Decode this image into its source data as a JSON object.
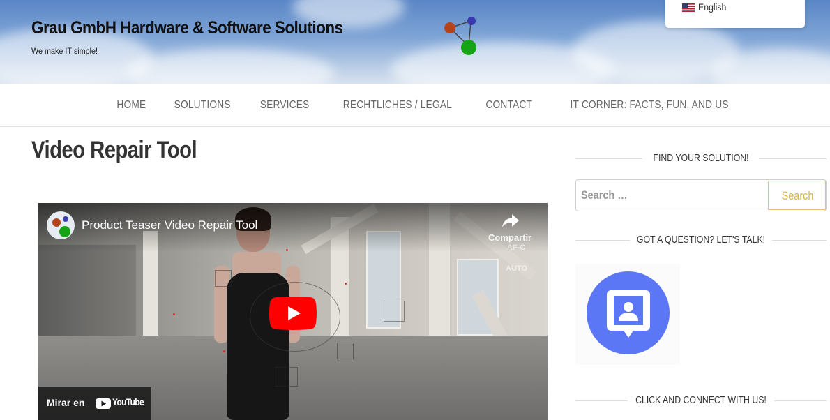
{
  "header": {
    "site_title": "Grau GmbH Hardware & Software Solutions",
    "tagline": "We make IT simple!",
    "language": "English"
  },
  "nav": {
    "items": [
      "HOME",
      "SOLUTIONS",
      "SERVICES",
      "RECHTLICHES / LEGAL",
      "CONTACT",
      "IT CORNER: FACTS, FUN, AND US"
    ]
  },
  "main": {
    "page_title": "Video Repair Tool",
    "video": {
      "title": "Product Teaser Video Repair Tool",
      "share_label": "Compartir",
      "hud_af": "AF-C",
      "hud_auto": "AUTO",
      "watch_on": "Mirar en",
      "youtube": "YouTube"
    }
  },
  "sidebar": {
    "search_heading": "FIND YOUR SOLUTION!",
    "search_placeholder": "Search …",
    "search_button": "Search",
    "contact_heading": "GOT A QUESTION? LET'S TALK!",
    "connect_heading": "CLICK AND CONNECT WITH US!"
  },
  "colors": {
    "accent_gold": "#d4b34a",
    "contact_blue": "#5b77f5",
    "youtube_red": "#ff0000"
  }
}
